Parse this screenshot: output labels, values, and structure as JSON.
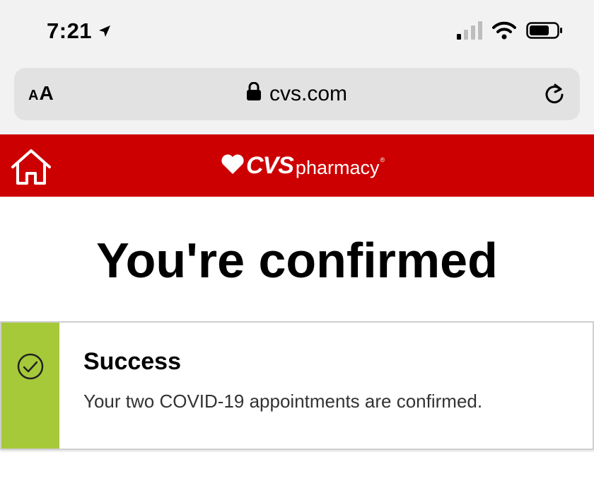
{
  "status_bar": {
    "time": "7:21",
    "icons": [
      "location-arrow-icon",
      "cellular-signal-icon",
      "wifi-icon",
      "battery-icon"
    ]
  },
  "browser": {
    "text_size_label": "AA",
    "url": "cvs.com",
    "icons": [
      "lock-icon",
      "reload-icon"
    ]
  },
  "header": {
    "background_color": "#cc0000",
    "logo_brand": "CVS",
    "logo_suffix": "pharmacy",
    "logo_registered": "®",
    "icons": [
      "home-icon",
      "heart-icon"
    ]
  },
  "main": {
    "title": "You're confirmed"
  },
  "alert": {
    "accent_color": "#a6c93a",
    "title": "Success",
    "message": "Your two COVID-19 appointments are confirmed.",
    "icon": "check-circle-icon"
  }
}
